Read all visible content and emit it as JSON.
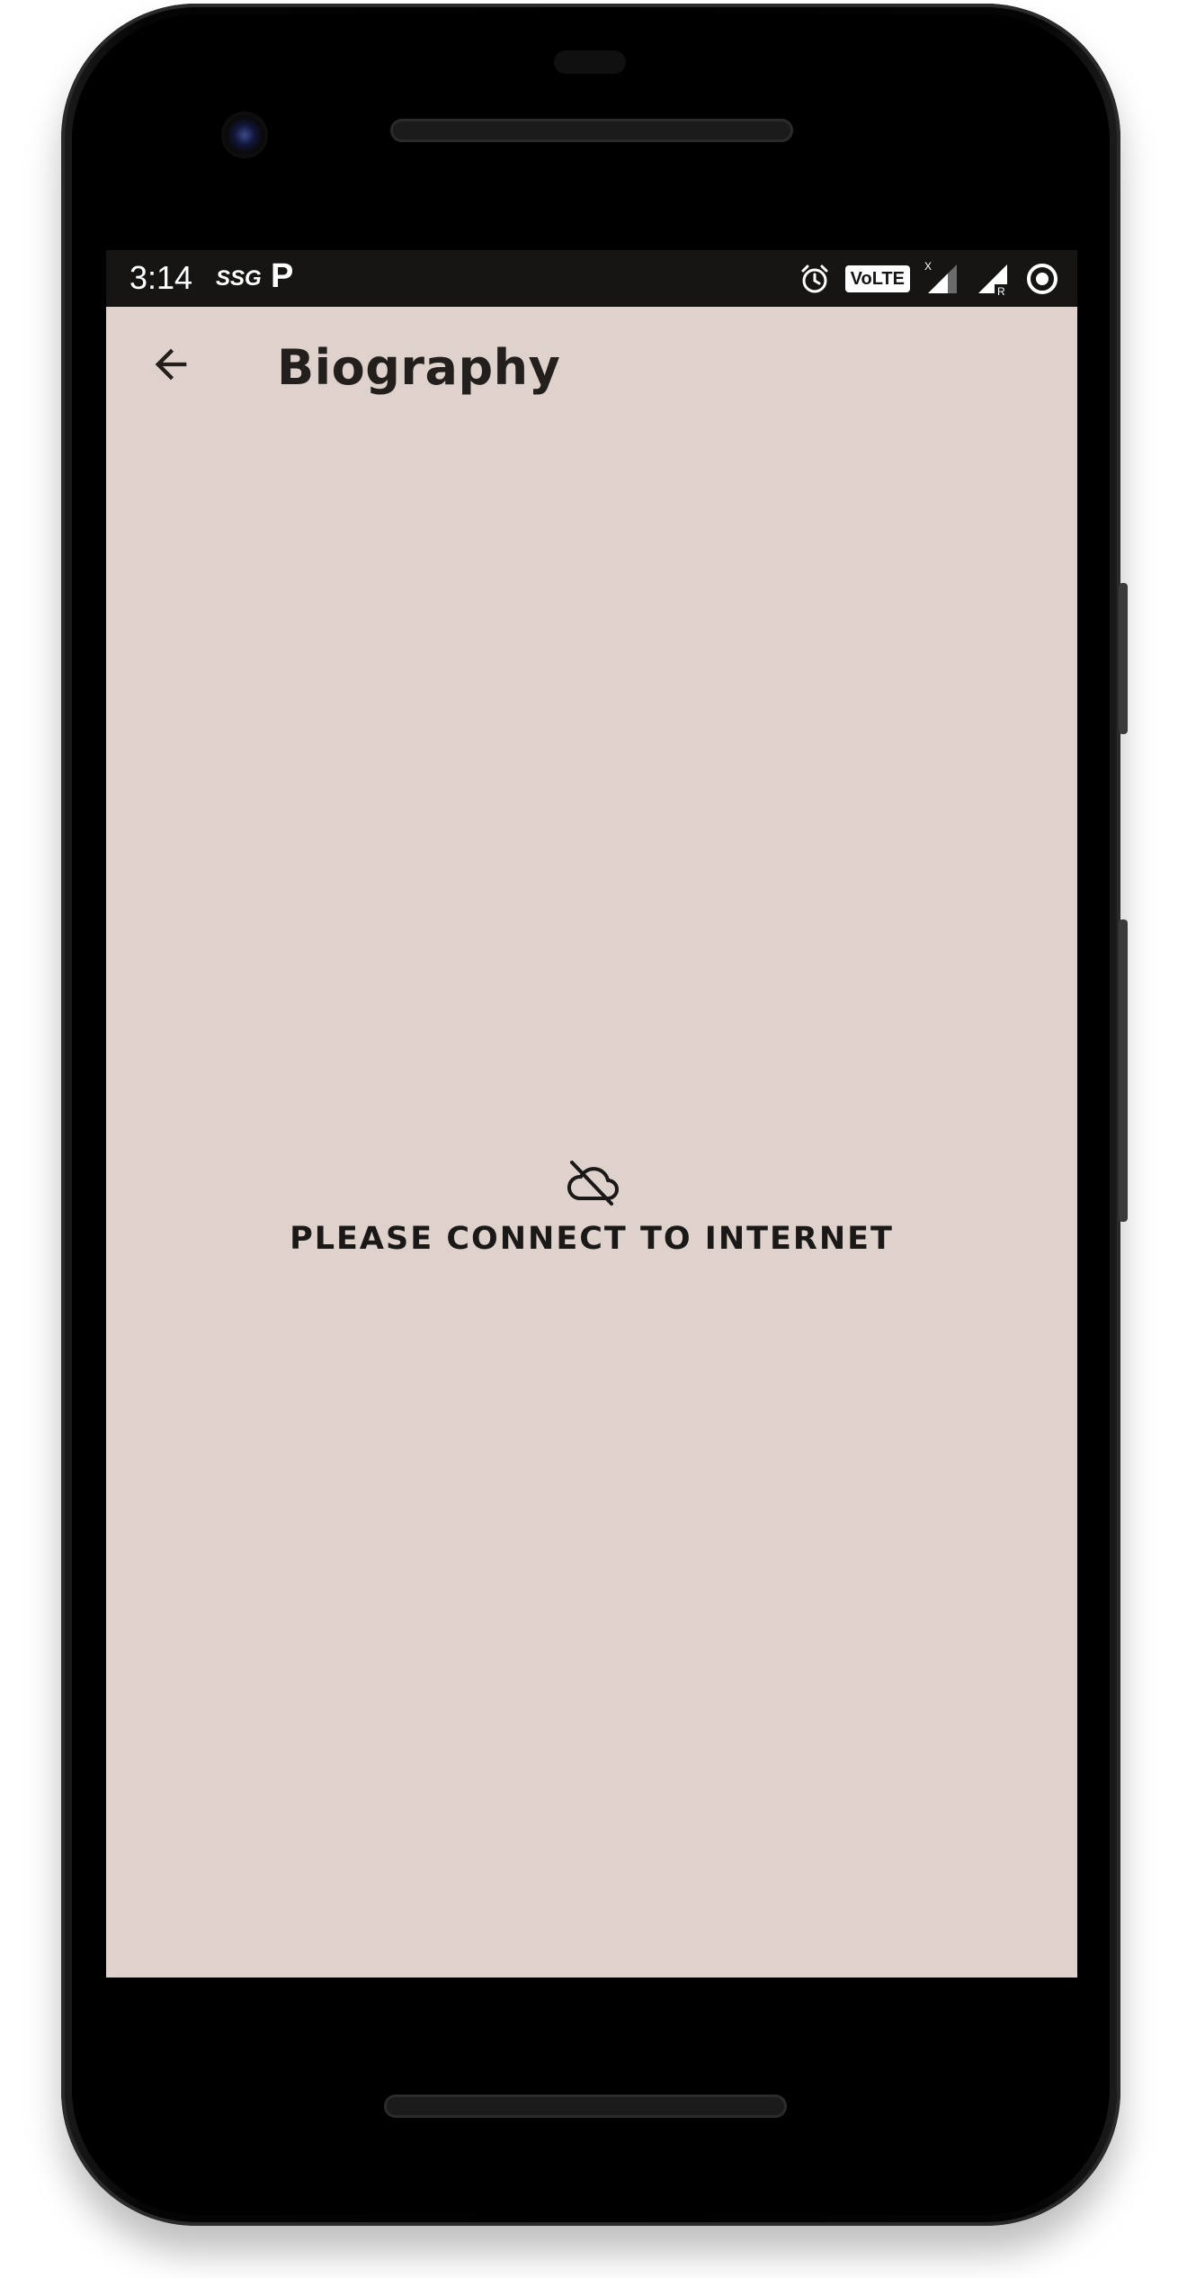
{
  "status_bar": {
    "time": "3:14",
    "carrier_label": "SSG",
    "app_badge": "P",
    "volte_label": "VoLTE",
    "signal_secondary_label": "R",
    "data_indicator": "X"
  },
  "app_bar": {
    "title": "Biography",
    "back_icon": "arrow-back-icon"
  },
  "main": {
    "offline_icon": "cloud-off-icon",
    "offline_message": "PLEASE CONNECT TO INTERNET"
  },
  "colors": {
    "screen_background": "#dfd2cc",
    "status_bar_background": "#161514",
    "text_primary": "#221f1d"
  }
}
